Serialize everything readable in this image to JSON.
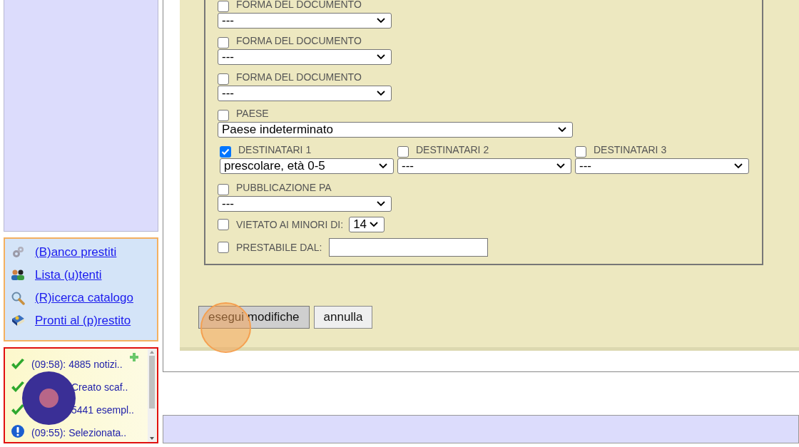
{
  "menu": [
    {
      "label": "(B)anco prestiti"
    },
    {
      "label": "Lista (u)tenti"
    },
    {
      "label": "(R)icerca catalogo"
    },
    {
      "label": "Pronti al (p)restito"
    }
  ],
  "log": [
    {
      "kind": "ok",
      "text": "(09:58): 4885 notizi..",
      "covered": false
    },
    {
      "kind": "ok",
      "text": "Creato scaf..",
      "covered": true
    },
    {
      "kind": "ok",
      "text": "5441 esempl..",
      "covered": true
    },
    {
      "kind": "info",
      "text": "(09:55): Selezionata..",
      "covered": false
    }
  ],
  "form": [
    {
      "kind": "select",
      "label": "FORMA DEL DOCUMENTO",
      "checked": false,
      "value": "---"
    },
    {
      "kind": "select",
      "label": "FORMA DEL DOCUMENTO",
      "checked": false,
      "value": "---"
    },
    {
      "kind": "select",
      "label": "FORMA DEL DOCUMENTO",
      "checked": false,
      "value": "---"
    },
    {
      "kind": "wide-select",
      "label": "PAESE",
      "checked": false,
      "value": "Paese indeterminato"
    },
    {
      "kind": "group",
      "items": [
        {
          "label": "DESTINATARI 1",
          "checked": true,
          "value": "prescolare, età 0-5"
        },
        {
          "label": "DESTINATARI 2",
          "checked": false,
          "value": "---"
        },
        {
          "label": "DESTINATARI 3",
          "checked": false,
          "value": "---"
        }
      ]
    },
    {
      "kind": "select",
      "label": "PUBBLICAZIONE PA",
      "checked": false,
      "value": "---"
    },
    {
      "kind": "inline-select",
      "label": "VIETATO AI MINORI DI:",
      "checked": false,
      "value": "14"
    },
    {
      "kind": "text",
      "label": "PRESTABILE DAL:",
      "checked": false
    }
  ],
  "buttons": [
    {
      "label": "esegui modifiche",
      "pressed": true
    },
    {
      "label": "annulla",
      "pressed": false
    }
  ]
}
